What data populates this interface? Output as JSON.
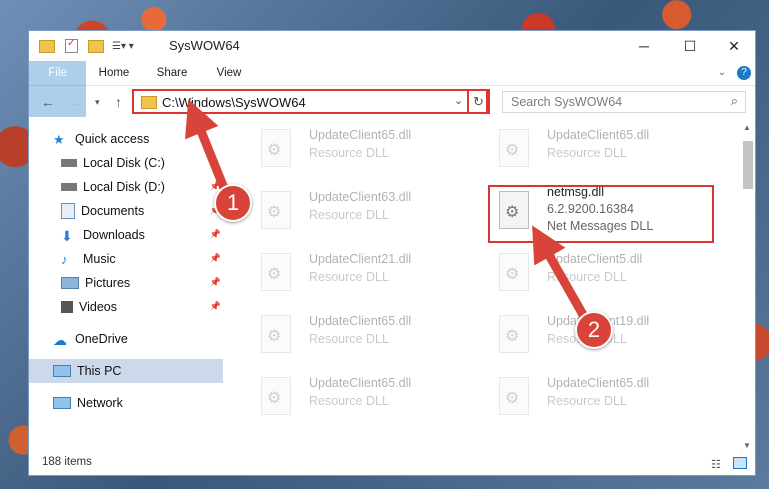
{
  "window": {
    "title": "SysWOW64",
    "minimize": "─",
    "maximize": "☐",
    "close": "✕"
  },
  "ribbon": {
    "tabs": [
      {
        "label": "File"
      },
      {
        "label": "Home"
      },
      {
        "label": "Share"
      },
      {
        "label": "View"
      }
    ]
  },
  "address": {
    "path": "C:\\Windows\\SysWOW64"
  },
  "search": {
    "placeholder": "Search SysWOW64"
  },
  "sidebar": {
    "items": [
      {
        "label": "Quick access",
        "icon": "star-icon"
      },
      {
        "label": "Local Disk (C:)",
        "icon": "drive-icon"
      },
      {
        "label": "Local Disk (D:)",
        "icon": "drive-icon"
      },
      {
        "label": "Documents",
        "icon": "documents-icon"
      },
      {
        "label": "Downloads",
        "icon": "download-icon"
      },
      {
        "label": "Music",
        "icon": "music-icon"
      },
      {
        "label": "Pictures",
        "icon": "pictures-icon"
      },
      {
        "label": "Videos",
        "icon": "videos-icon"
      },
      {
        "label": "OneDrive",
        "icon": "cloud-icon"
      },
      {
        "label": "This PC",
        "icon": "computer-icon"
      },
      {
        "label": "Network",
        "icon": "network-icon"
      }
    ]
  },
  "files": [
    {
      "name": "UpdateClient65.dll",
      "sub": "Resource DLL"
    },
    {
      "name": "UpdateClient65.dll",
      "sub": "Resource DLL"
    },
    {
      "name": "UpdateClient63.dll",
      "sub": "Resource DLL"
    },
    {
      "name": "netmsg.dll",
      "version": "6.2.9200.16384",
      "sub": "Net Messages DLL"
    },
    {
      "name": "UpdateClient21.dll",
      "sub": "Resource DLL"
    },
    {
      "name": "UpdateClient5.dll",
      "sub": "Resource DLL"
    },
    {
      "name": "UpdateClient65.dll",
      "sub": "Resource DLL"
    },
    {
      "name": "UpdateClient19.dll",
      "sub": "Resource DLL"
    },
    {
      "name": "UpdateClient65.dll",
      "sub": "Resource DLL"
    },
    {
      "name": "UpdateClient65.dll",
      "sub": "Resource DLL"
    }
  ],
  "status": {
    "item_count": "188 items"
  },
  "badges": {
    "one": "1",
    "two": "2"
  }
}
